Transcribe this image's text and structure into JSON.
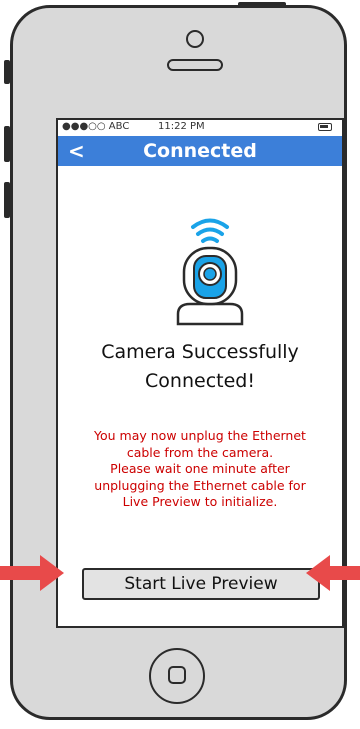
{
  "status_bar": {
    "carrier": "●●●○○ ABC",
    "time": "11:22 PM",
    "battery_icon": "battery-icon"
  },
  "nav": {
    "back_glyph": "<",
    "title": "Connected"
  },
  "content": {
    "illustration": "wifi-camera-icon",
    "headline_line1": "Camera Successfully",
    "headline_line2": "Connected!",
    "notice_lines": [
      "You may now unplug the Ethernet",
      "cable from the camera.",
      "Please wait one minute after",
      "unplugging the Ethernet cable for",
      "Live Preview to initialize."
    ],
    "start_button": "Start Live Preview"
  },
  "colors": {
    "nav_bar": "#3c7fd9",
    "notice_text": "#cc0000",
    "arrow": "#e84a4a",
    "camera_accent": "#1aa3e8"
  }
}
